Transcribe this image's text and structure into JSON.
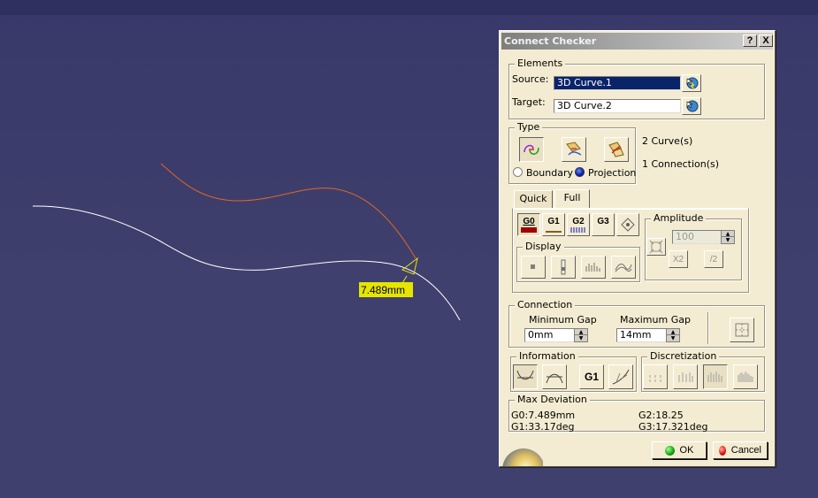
{
  "viewport": {
    "measurement_label": "7.489mm",
    "colors": {
      "background": "#3c3c6a",
      "source_curve": "#ffffff",
      "target_curve": "#e06820",
      "label_bg": "#e5e500"
    }
  },
  "dialog": {
    "title": "Connect Checker",
    "help_label": "?",
    "close_label": "X",
    "elements": {
      "legend": "Elements",
      "source_label": "Source:",
      "source_value": "3D Curve.1",
      "target_label": "Target:",
      "target_value": "3D Curve.2"
    },
    "type": {
      "legend": "Type",
      "curve_count": "2 Curve(s)",
      "connection_count": "1 Connection(s)",
      "boundary_label": "Boundary",
      "projection_label": "Projection",
      "selected": "Projection"
    },
    "tabs": {
      "quick": "Quick",
      "full": "Full",
      "active": "Full"
    },
    "continuity": {
      "g0": "G0",
      "g1": "G1",
      "g2": "G2",
      "g3": "G3"
    },
    "amplitude": {
      "legend": "Amplitude",
      "value": "100",
      "x2": "X2",
      "div2": "/2"
    },
    "display": {
      "legend": "Display"
    },
    "connection": {
      "legend": "Connection",
      "min_gap_label": "Minimum Gap",
      "min_gap_value": "0mm",
      "max_gap_label": "Maximum Gap",
      "max_gap_value": "14mm"
    },
    "information": {
      "legend": "Information",
      "g1_label": "G1"
    },
    "discretization": {
      "legend": "Discretization"
    },
    "max_deviation": {
      "legend": "Max Deviation",
      "g0": "G0:7.489mm",
      "g1": "G1:33.17deg",
      "g2": "G2:18.25",
      "g3": "G3:17.321deg"
    },
    "ok_label": "OK",
    "cancel_label": "Cancel"
  }
}
